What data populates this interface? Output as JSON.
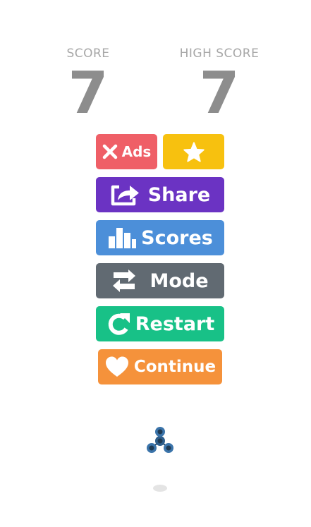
{
  "scores": {
    "score_label": "SCORE",
    "score_value": "7",
    "high_label": "HIGH SCORE",
    "high_value": "7"
  },
  "buttons": {
    "ads": {
      "label": "Ads",
      "icon": "close-icon",
      "color": "#ef5f67"
    },
    "rate": {
      "icon": "star-icon",
      "color": "#f7c10f"
    },
    "share": {
      "label": "Share",
      "icon": "share-icon",
      "color": "#6b33c3"
    },
    "scores": {
      "label": "Scores",
      "icon": "bar-chart-icon",
      "color": "#4c8fd9"
    },
    "mode": {
      "label": "Mode",
      "icon": "swap-icon",
      "color": "#616a72"
    },
    "restart": {
      "label": "Restart",
      "icon": "restart-icon",
      "color": "#18c187"
    },
    "continue": {
      "label": "Continue",
      "icon": "heart-icon",
      "color": "#f5923b"
    }
  },
  "game": {
    "character": "fidget-spinner-icon"
  }
}
